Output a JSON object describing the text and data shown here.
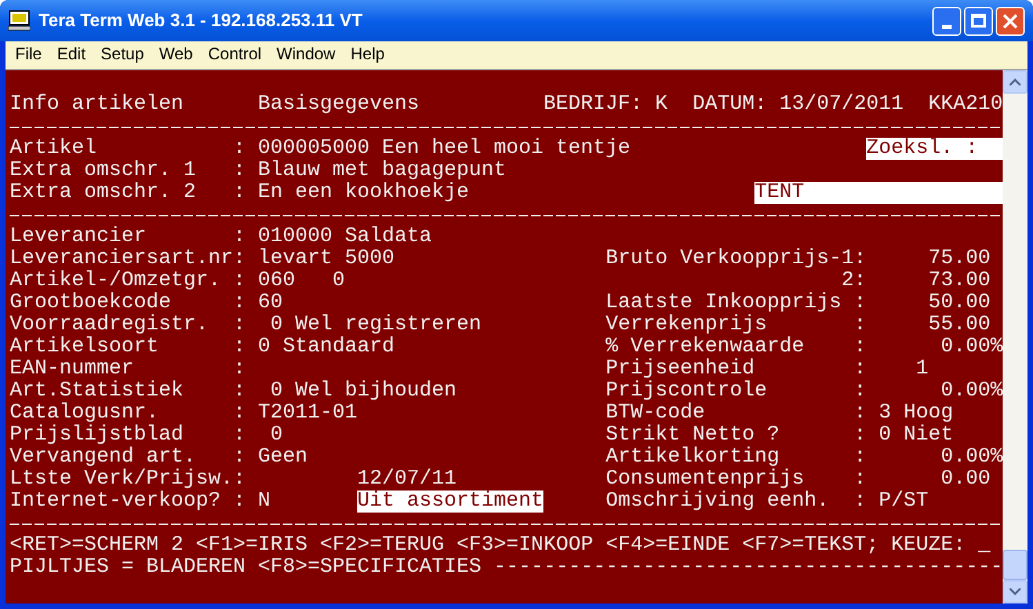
{
  "window": {
    "title": "Tera Term Web 3.1 - 192.168.253.11 VT"
  },
  "menu": [
    "File",
    "Edit",
    "Setup",
    "Web",
    "Control",
    "Window",
    "Help"
  ],
  "terminal": {
    "header": [
      "Info artikelen",
      "Basisgegevens",
      "BEDRIJF: K",
      "DATUM: 13/07/2011",
      "KKA210"
    ],
    "article": [
      {
        "label": "Artikel",
        "sep": ":",
        "value": "000005000 Een heel mooi tentje",
        "field": {
          "text": "Zoeksl. :",
          "kind": "label"
        }
      },
      {
        "label": "Extra omschr. 1",
        "sep": ":",
        "value": "Blauw met bagagepunt"
      },
      {
        "label": "Extra omschr. 2",
        "sep": ":",
        "value": "En een kookhoekje",
        "field": {
          "text": "TENT",
          "kind": "input"
        }
      }
    ],
    "rows": [
      {
        "left": {
          "label": "Leverancier",
          "sep": ":",
          "value": "010000 Saldata"
        }
      },
      {
        "left": {
          "label": "Leveranciersart.nr",
          "sep": ":",
          "value": "levart 5000"
        },
        "right": {
          "label": "Bruto Verkoopprijs-1",
          "sep": ":",
          "value": "75.00",
          "kind": "number"
        }
      },
      {
        "left": {
          "label": "Artikel-/Omzetgr.",
          "sep": ":",
          "value": "060   0"
        },
        "right": {
          "label": "2",
          "sep": ":",
          "value": "73.00",
          "kind": "number",
          "continuation": true
        }
      },
      {
        "left": {
          "label": "Grootboekcode",
          "sep": ":",
          "value": "60"
        },
        "right": {
          "label": "Laatste Inkoopprijs",
          "sep": ":",
          "value": "50.00",
          "kind": "number"
        }
      },
      {
        "left": {
          "label": "Voorraadregistr.",
          "sep": ":",
          "value": " 0 Wel registreren"
        },
        "right": {
          "label": "Verrekenprijs",
          "sep": ":",
          "value": "55.00",
          "kind": "number"
        }
      },
      {
        "left": {
          "label": "Artikelsoort",
          "sep": ":",
          "value": "0 Standaard"
        },
        "right": {
          "label": "% Verrekenwaarde",
          "sep": ":",
          "value": "0.00",
          "suffix": "%",
          "kind": "number"
        }
      },
      {
        "left": {
          "label": "EAN-nummer",
          "sep": ":"
        },
        "right": {
          "label": "Prijseenheid",
          "sep": ":",
          "value": "   1",
          "kind": "text"
        }
      },
      {
        "left": {
          "label": "Art.Statistiek",
          "sep": ":",
          "value": " 0 Wel bijhouden"
        },
        "right": {
          "label": "Prijscontrole",
          "sep": ":",
          "value": "0.00",
          "suffix": "%",
          "kind": "number"
        }
      },
      {
        "left": {
          "label": "Catalogusnr.",
          "sep": ":",
          "value": "T2011-01"
        },
        "right": {
          "label": "BTW-code",
          "sep": ":",
          "value": "3 Hoog",
          "kind": "text"
        }
      },
      {
        "left": {
          "label": "Prijslijstblad",
          "sep": ":",
          "value": " 0"
        },
        "right": {
          "label": "Strikt Netto ?",
          "sep": ":",
          "value": "0 Niet",
          "kind": "text"
        }
      },
      {
        "left": {
          "label": "Vervangend art.",
          "sep": ":",
          "value": "Geen"
        },
        "right": {
          "label": "Artikelkorting",
          "sep": ":",
          "value": "0.00",
          "suffix": "%",
          "kind": "number"
        }
      },
      {
        "left": {
          "label": "Ltste Verk/Prijsw.",
          "sep": ":",
          "note": {
            "text": "12/07/11",
            "highlighted": false
          }
        },
        "right": {
          "label": "Consumentenprijs",
          "sep": ":",
          "value": "0.00",
          "kind": "number"
        }
      },
      {
        "left": {
          "label": "Internet-verkoop?",
          "sep": ":",
          "value": "N",
          "note": {
            "text": "Uit assortiment",
            "highlighted": true
          }
        },
        "right": {
          "label": "Omschrijving eenh.",
          "sep": ":",
          "value": "P/ST",
          "kind": "text"
        }
      }
    ],
    "footer": [
      "<RET>=SCHERM 2 <F1>=IRIS <F2>=TERUG <F3>=INKOOP <F4>=EINDE <F7>=TEKST; KEUZE: _",
      "PIJLTJES = BLADEREN <F8>=SPECIFICATIES -----------------------------------------"
    ]
  }
}
